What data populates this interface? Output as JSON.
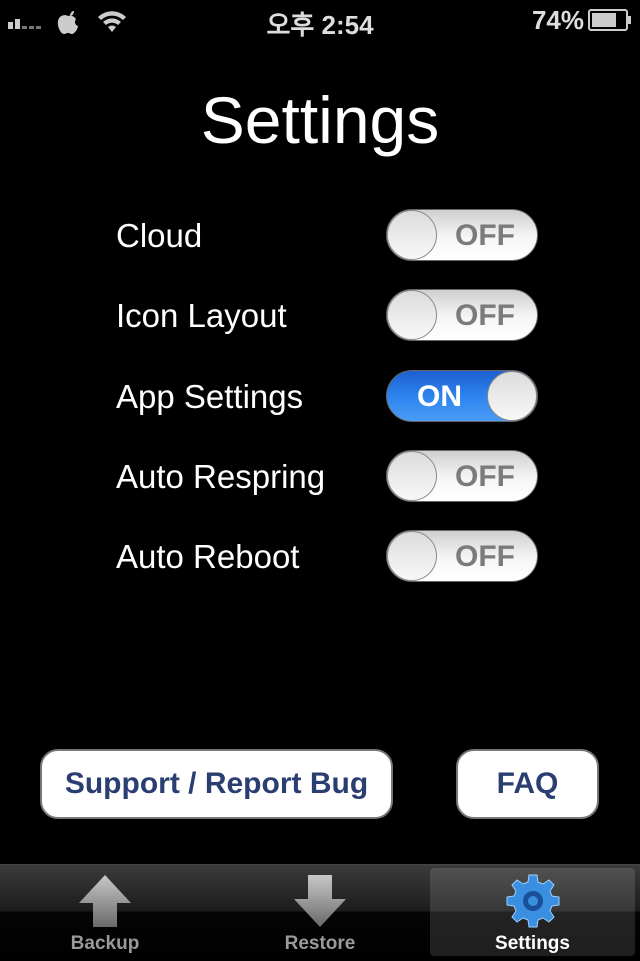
{
  "status_bar": {
    "time": "오후 2:54",
    "battery_percent": "74%",
    "battery_level": 0.74
  },
  "title": "Settings",
  "settings": [
    {
      "label": "Cloud",
      "state": "OFF"
    },
    {
      "label": "Icon Layout",
      "state": "OFF"
    },
    {
      "label": "App Settings",
      "state": "ON"
    },
    {
      "label": "Auto Respring",
      "state": "OFF"
    },
    {
      "label": "Auto Reboot",
      "state": "OFF"
    }
  ],
  "buttons": {
    "support": "Support / Report Bug",
    "faq": "FAQ"
  },
  "tabs": [
    {
      "label": "Backup",
      "icon": "up-arrow-icon"
    },
    {
      "label": "Restore",
      "icon": "down-arrow-icon"
    },
    {
      "label": "Settings",
      "icon": "gear-icon",
      "selected": true
    }
  ],
  "colors": {
    "toggle_on": "#2f86f0",
    "button_text": "#2a3e72",
    "gear_blue": "#3a8fe0"
  }
}
